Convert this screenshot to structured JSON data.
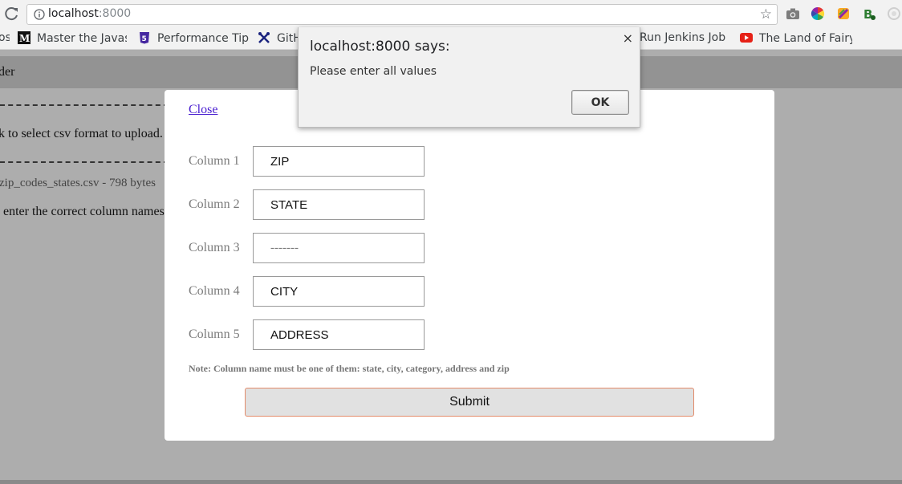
{
  "browser": {
    "url_host": "localhost",
    "url_port": ":8000",
    "bookmarks": [
      {
        "label": "os",
        "icon": "none"
      },
      {
        "label": "Master the Javas",
        "icon": "medium-icon"
      },
      {
        "label": "Performance Tip",
        "icon": "html5-icon"
      },
      {
        "label": "GitH",
        "icon": "tools-icon"
      },
      {
        "label": "Run Jenkins Job",
        "icon": "none"
      },
      {
        "label": "The Land of Fairy",
        "icon": "youtube-icon"
      }
    ]
  },
  "page": {
    "header": "der",
    "line1": "k to select csv format to upload.",
    "file_info": "zip_codes_states.csv - 798 bytes",
    "line2": "enter the correct column names"
  },
  "modal": {
    "close_label": "Close",
    "rows": [
      {
        "label": "Column 1",
        "value": "ZIP"
      },
      {
        "label": "Column 2",
        "value": "STATE"
      },
      {
        "label": "Column 3",
        "value": "-------"
      },
      {
        "label": "Column 4",
        "value": "CITY"
      },
      {
        "label": "Column 5",
        "value": "ADDRESS"
      }
    ],
    "note": "Note: Column name must be one of them: state, city, category, address and zip",
    "submit_label": "Submit"
  },
  "alert": {
    "title": "localhost:8000 says:",
    "message": "Please enter all values",
    "ok_label": "OK",
    "close_glyph": "×"
  },
  "colors": {
    "link": "#4a1fd0",
    "overlay": "#adadad",
    "submit_border": "#e38b6a"
  }
}
